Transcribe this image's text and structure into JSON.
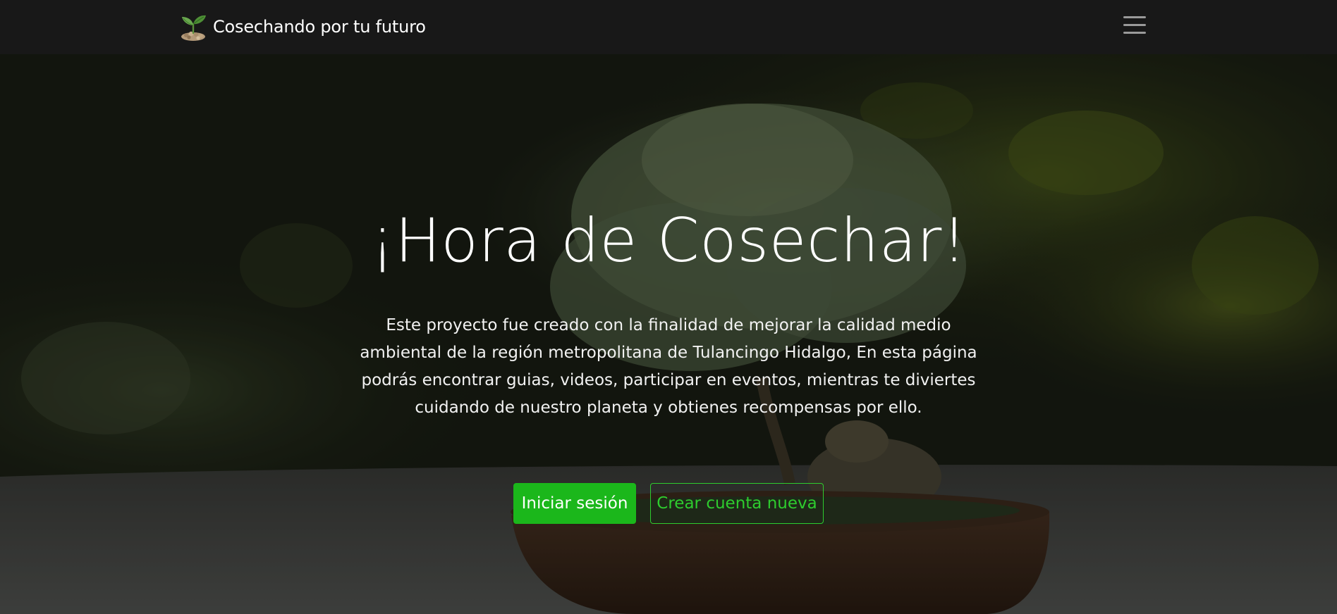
{
  "navbar": {
    "brand_name": "Cosechando por tu futuro",
    "brand_icon": "sprout-logo-icon",
    "menu_icon": "hamburger-menu-icon"
  },
  "hero": {
    "title": "¡Hora de Cosechar!",
    "description": "Este proyecto fue creado con la finalidad de mejorar la calidad medio ambiental de la región metropolitana de Tulancingo Hidalgo, En esta página podrás encontrar guias, videos, participar en eventos, mientras te diviertes cuidando de nuestro planeta y obtienes recompensas por ello.",
    "login_label": "Iniciar sesión",
    "signup_label": "Crear cuenta nueva",
    "background_image": "bonsai-tree-background"
  },
  "colors": {
    "navbar_bg": "#181818",
    "accent_green": "#1bb71b",
    "outline_green": "#2ecc2e",
    "text_white": "#ffffff"
  }
}
